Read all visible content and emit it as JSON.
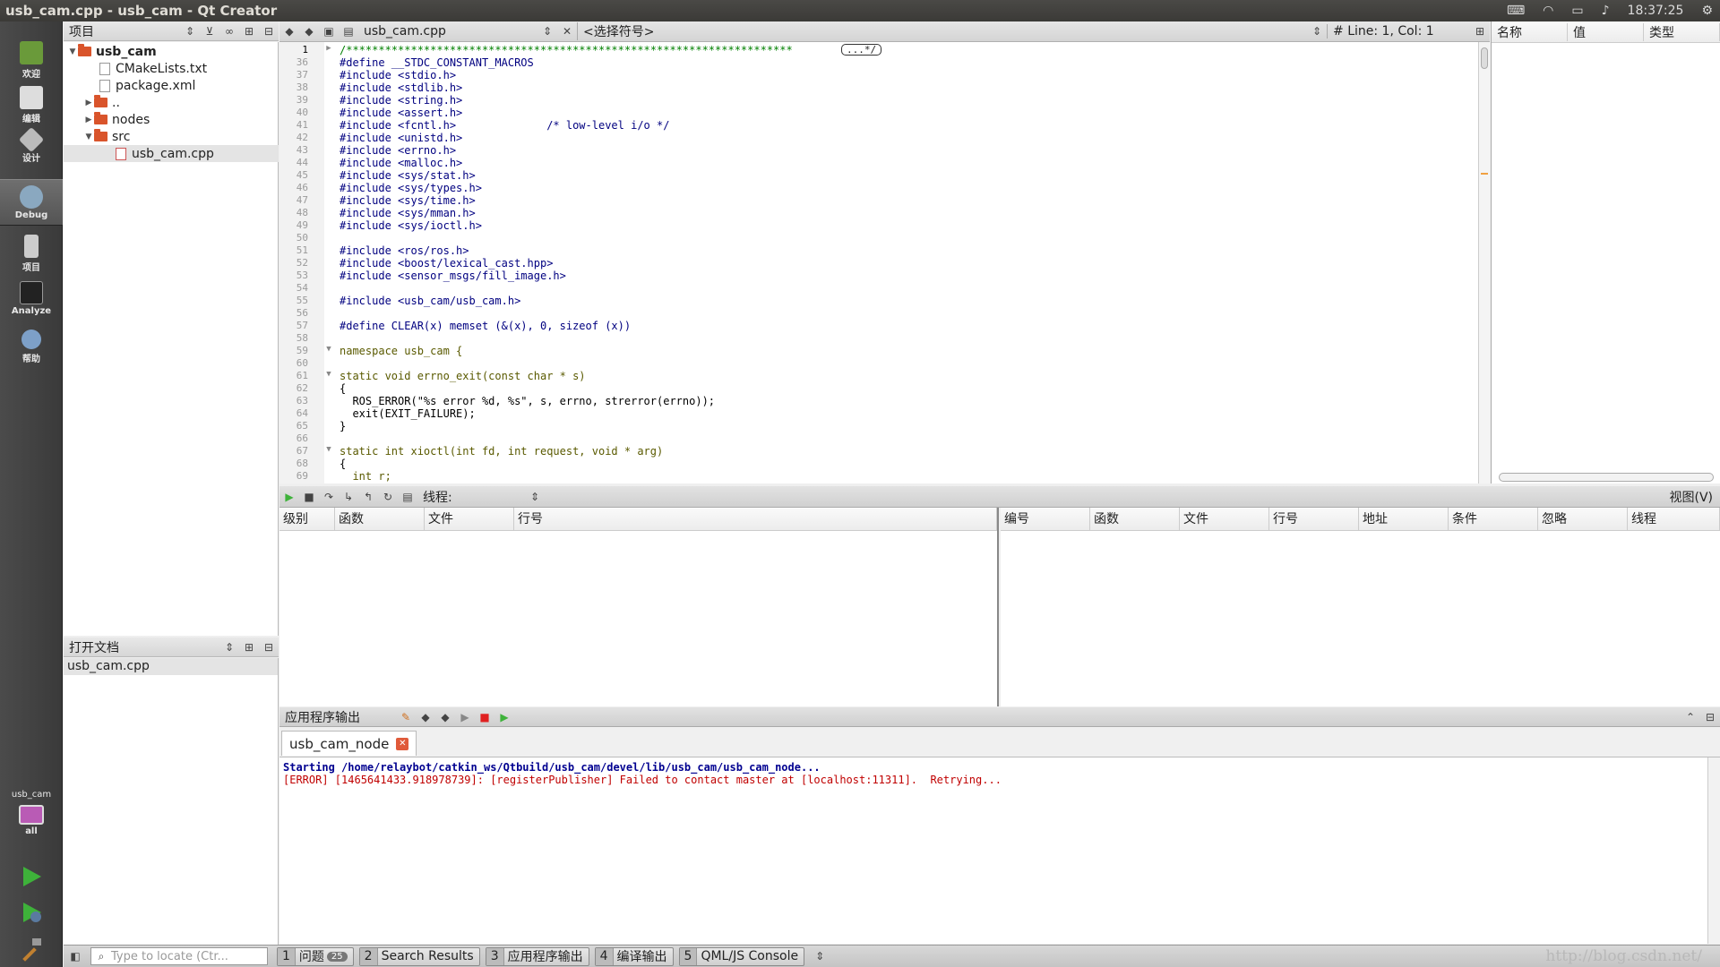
{
  "window": {
    "title": "usb_cam.cpp - usb_cam - Qt Creator",
    "clock": "18:37:25"
  },
  "modes": [
    {
      "label": "欢迎"
    },
    {
      "label": "编辑"
    },
    {
      "label": "设计"
    },
    {
      "label": "Debug"
    },
    {
      "label": "项目"
    },
    {
      "label": "Analyze"
    },
    {
      "label": "帮助"
    }
  ],
  "kit": {
    "project": "usb_cam",
    "config": "all"
  },
  "project_pane": {
    "title": "项目",
    "tree": [
      "usb_cam",
      "CMakeLists.txt",
      "package.xml",
      "..",
      "nodes",
      "src",
      "usb_cam.cpp"
    ]
  },
  "open_docs": {
    "title": "打开文档",
    "items": [
      "usb_cam.cpp"
    ]
  },
  "editor": {
    "file": "usb_cam.cpp",
    "symbol": "<选择符号>",
    "position": "Line: 1, Col: 1",
    "folded_marker": "...*/",
    "lines": [
      {
        "n": "1",
        "t": "/*********************************************************************"
      },
      {
        "n": "36",
        "t": "#define __STDC_CONSTANT_MACROS"
      },
      {
        "n": "37",
        "t": "#include <stdio.h>"
      },
      {
        "n": "38",
        "t": "#include <stdlib.h>"
      },
      {
        "n": "39",
        "t": "#include <string.h>"
      },
      {
        "n": "40",
        "t": "#include <assert.h>"
      },
      {
        "n": "41",
        "t": "#include <fcntl.h>              /* low-level i/o */"
      },
      {
        "n": "42",
        "t": "#include <unistd.h>"
      },
      {
        "n": "43",
        "t": "#include <errno.h>"
      },
      {
        "n": "44",
        "t": "#include <malloc.h>"
      },
      {
        "n": "45",
        "t": "#include <sys/stat.h>"
      },
      {
        "n": "46",
        "t": "#include <sys/types.h>"
      },
      {
        "n": "47",
        "t": "#include <sys/time.h>"
      },
      {
        "n": "48",
        "t": "#include <sys/mman.h>"
      },
      {
        "n": "49",
        "t": "#include <sys/ioctl.h>"
      },
      {
        "n": "50",
        "t": ""
      },
      {
        "n": "51",
        "t": "#include <ros/ros.h>"
      },
      {
        "n": "52",
        "t": "#include <boost/lexical_cast.hpp>"
      },
      {
        "n": "53",
        "t": "#include <sensor_msgs/fill_image.h>"
      },
      {
        "n": "54",
        "t": ""
      },
      {
        "n": "55",
        "t": "#include <usb_cam/usb_cam.h>"
      },
      {
        "n": "56",
        "t": ""
      },
      {
        "n": "57",
        "t": "#define CLEAR(x) memset (&(x), 0, sizeof (x))"
      },
      {
        "n": "58",
        "t": ""
      },
      {
        "n": "59",
        "t": "namespace usb_cam {"
      },
      {
        "n": "60",
        "t": ""
      },
      {
        "n": "61",
        "t": "static void errno_exit(const char * s)"
      },
      {
        "n": "62",
        "t": "{"
      },
      {
        "n": "63",
        "t": "  ROS_ERROR(\"%s error %d, %s\", s, errno, strerror(errno));"
      },
      {
        "n": "64",
        "t": "  exit(EXIT_FAILURE);"
      },
      {
        "n": "65",
        "t": "}"
      },
      {
        "n": "66",
        "t": ""
      },
      {
        "n": "67",
        "t": "static int xioctl(int fd, int request, void * arg)"
      },
      {
        "n": "68",
        "t": "{"
      },
      {
        "n": "69",
        "t": "  int r;"
      }
    ]
  },
  "locals": {
    "columns": [
      "名称",
      "值",
      "类型"
    ]
  },
  "debugger": {
    "thread_label": "线程:",
    "views": "视图(V)",
    "stack_columns": [
      "级别",
      "函数",
      "文件",
      "行号"
    ],
    "breakpoint_columns": [
      "编号",
      "函数",
      "文件",
      "行号",
      "地址",
      "条件",
      "忽略",
      "线程"
    ]
  },
  "output": {
    "title": "应用程序输出",
    "tab": "usb_cam_node",
    "line1": "Starting /home/relaybot/catkin_ws/Qtbuild/usb_cam/devel/lib/usb_cam/usb_cam_node...",
    "line2": "[ERROR] [1465641433.918978739]: [registerPublisher] Failed to contact master at [localhost:11311].  Retrying..."
  },
  "statusbar": {
    "locate_placeholder": "Type to locate (Ctr...",
    "buttons": [
      {
        "n": "1",
        "label": "问题",
        "badge": "25"
      },
      {
        "n": "2",
        "label": "Search Results"
      },
      {
        "n": "3",
        "label": "应用程序输出"
      },
      {
        "n": "4",
        "label": "编译输出"
      },
      {
        "n": "5",
        "label": "QML/JS Console"
      }
    ]
  },
  "watermark": "http://blog.csdn.net/"
}
